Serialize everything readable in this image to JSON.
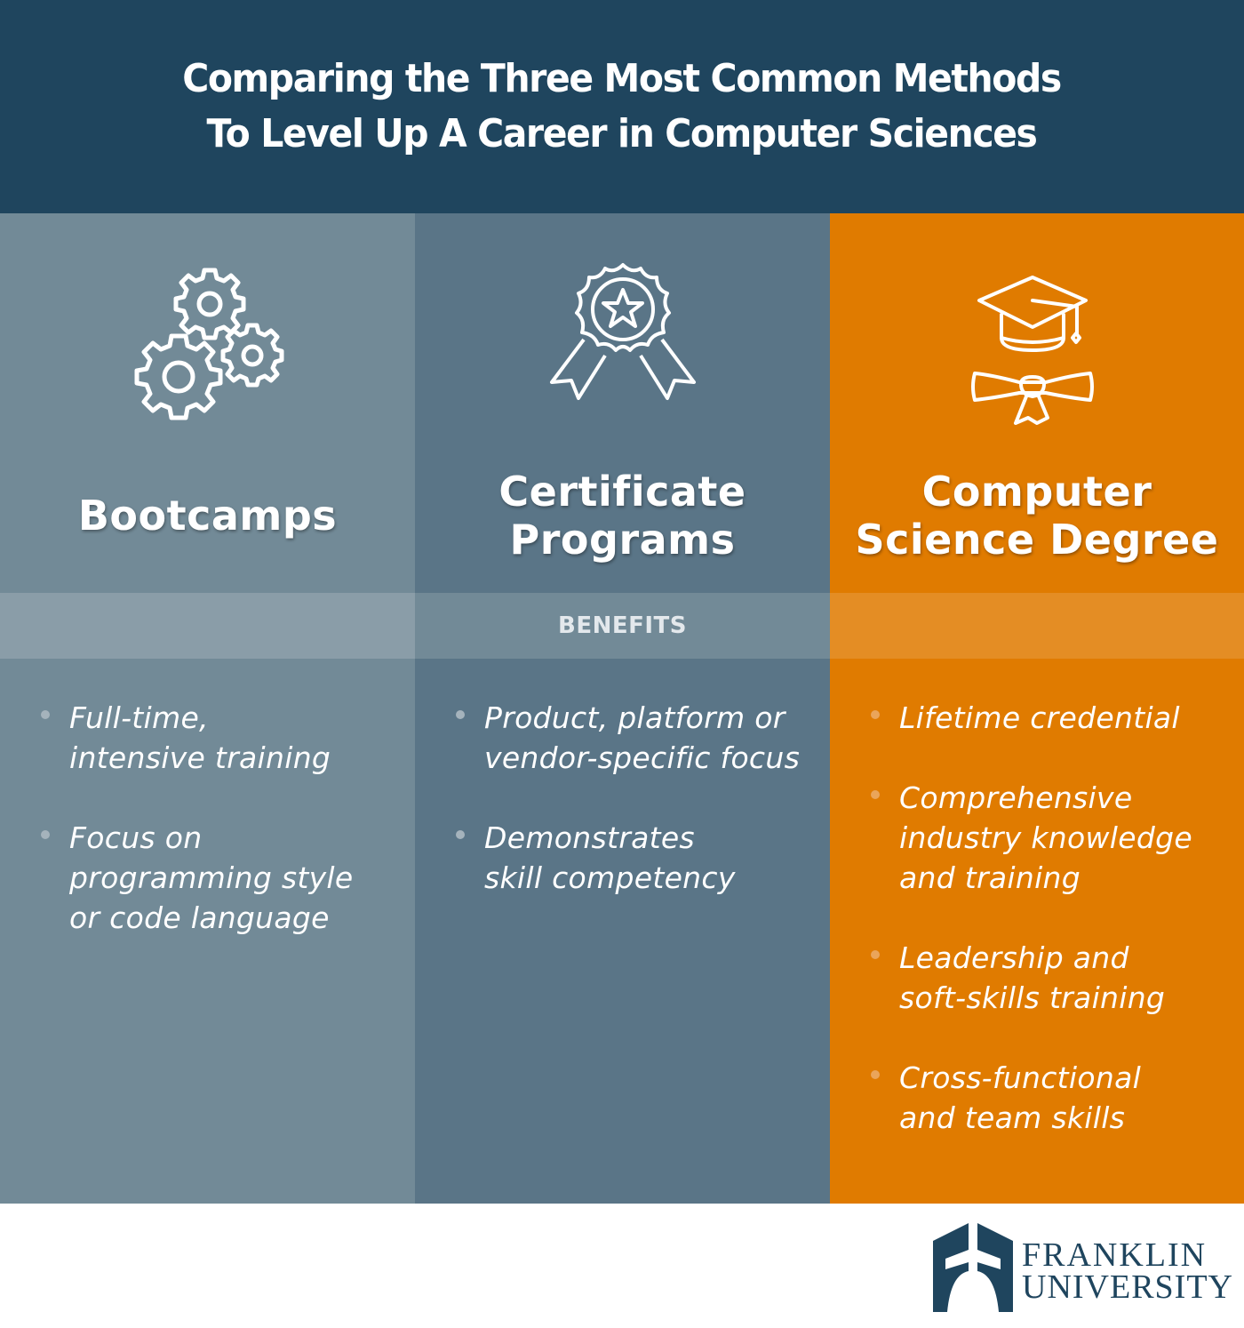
{
  "header": {
    "title_line1": "Comparing the Three Most Common Methods",
    "title_line2": "To Level Up A Career in Computer Sciences",
    "background": "#1f455e"
  },
  "section_label": "BENEFITS",
  "columns": [
    {
      "title_line1": "Bootcamps",
      "title_line2": "",
      "icon": "gears-icon",
      "background": "#728a97",
      "benefits": [
        {
          "line1": "Full-time,",
          "line2": "intensive training",
          "line3": ""
        },
        {
          "line1": "Focus on",
          "line2": "programming style",
          "line3": "or code language"
        }
      ]
    },
    {
      "title_line1": "Certificate",
      "title_line2": "Programs",
      "icon": "award-ribbon-icon",
      "background": "#5a7587",
      "benefits": [
        {
          "line1": "Product, platform or",
          "line2": "vendor-specific focus",
          "line3": ""
        },
        {
          "line1": "Demonstrates",
          "line2": "skill competency",
          "line3": ""
        }
      ]
    },
    {
      "title_line1": "Computer",
      "title_line2": "Science Degree",
      "icon": "graduation-cap-diploma-icon",
      "background": "#e07b00",
      "benefits": [
        {
          "line1": "Lifetime credential",
          "line2": "",
          "line3": ""
        },
        {
          "line1": "Comprehensive",
          "line2": "industry knowledge",
          "line3": "and training"
        },
        {
          "line1": "Leadership and",
          "line2": "soft-skills training",
          "line3": ""
        },
        {
          "line1": "Cross-functional",
          "line2": "and team skills",
          "line3": ""
        }
      ]
    }
  ],
  "logo": {
    "line1": "FRANKLIN",
    "line2": "UNIVERSITY",
    "color": "#1f455e"
  }
}
